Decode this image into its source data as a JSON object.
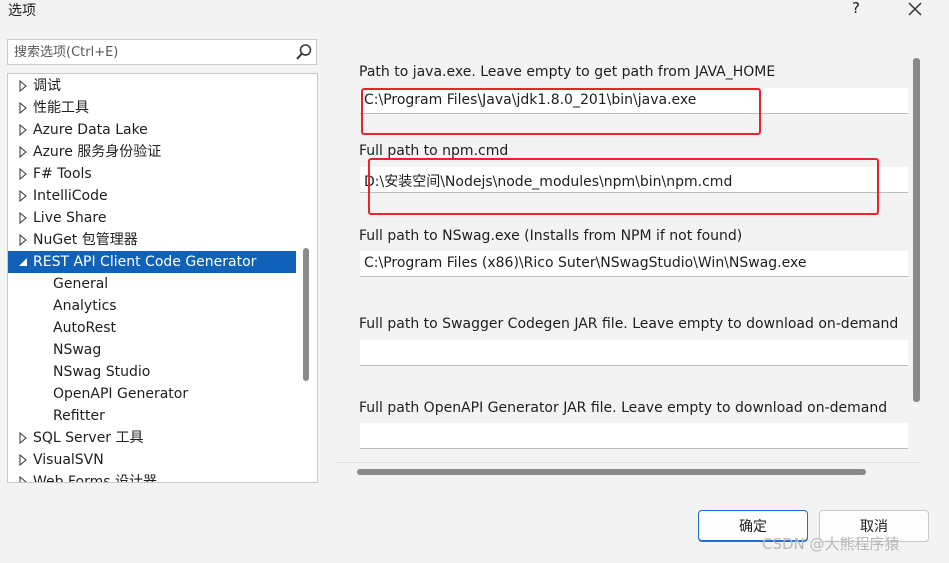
{
  "window": {
    "title": "选项",
    "help_label": "?"
  },
  "search": {
    "placeholder": "搜索选项(Ctrl+E)"
  },
  "tree": {
    "items": [
      {
        "label": "调试",
        "expandable": true
      },
      {
        "label": "性能工具",
        "expandable": true
      },
      {
        "label": "Azure Data Lake",
        "expandable": true
      },
      {
        "label": "Azure 服务身份验证",
        "expandable": true
      },
      {
        "label": "F# Tools",
        "expandable": true
      },
      {
        "label": "IntelliCode",
        "expandable": true
      },
      {
        "label": "Live Share",
        "expandable": true
      },
      {
        "label": "NuGet 包管理器",
        "expandable": true
      },
      {
        "label": "REST API Client Code Generator",
        "expanded": true,
        "selected": true
      },
      {
        "label": "General",
        "child": true
      },
      {
        "label": "Analytics",
        "child": true
      },
      {
        "label": "AutoRest",
        "child": true
      },
      {
        "label": "NSwag",
        "child": true
      },
      {
        "label": "NSwag Studio",
        "child": true
      },
      {
        "label": "OpenAPI Generator",
        "child": true
      },
      {
        "label": "Refitter",
        "child": true
      },
      {
        "label": "SQL Server 工具",
        "expandable": true
      },
      {
        "label": "VisualSVN",
        "expandable": true
      },
      {
        "label": "Web Forms 设计器",
        "expandable": true
      }
    ]
  },
  "settings": {
    "fields": [
      {
        "label": "Path to java.exe. Leave empty to get path from JAVA_HOME",
        "value": "C:\\Program Files\\Java\\jdk1.8.0_201\\bin\\java.exe"
      },
      {
        "label": "Full path to npm.cmd",
        "value": "D:\\安装空间\\Nodejs\\node_modules\\npm\\bin\\npm.cmd"
      },
      {
        "label": "Full path to NSwag.exe (Installs from NPM if not found)",
        "value": "C:\\Program Files (x86)\\Rico Suter\\NSwagStudio\\Win\\NSwag.exe"
      },
      {
        "label": "Full path to Swagger Codegen JAR file. Leave empty to download on-demand",
        "value": ""
      },
      {
        "label": "Full path OpenAPI Generator JAR file. Leave empty to download on-demand",
        "value": ""
      }
    ]
  },
  "buttons": {
    "ok": "确定",
    "cancel": "取消"
  },
  "watermark": "CSDN @大熊程序猿",
  "colors": {
    "selection": "#0f62b8",
    "highlight": "#e8232a",
    "primary_border": "#1f6fcc"
  }
}
